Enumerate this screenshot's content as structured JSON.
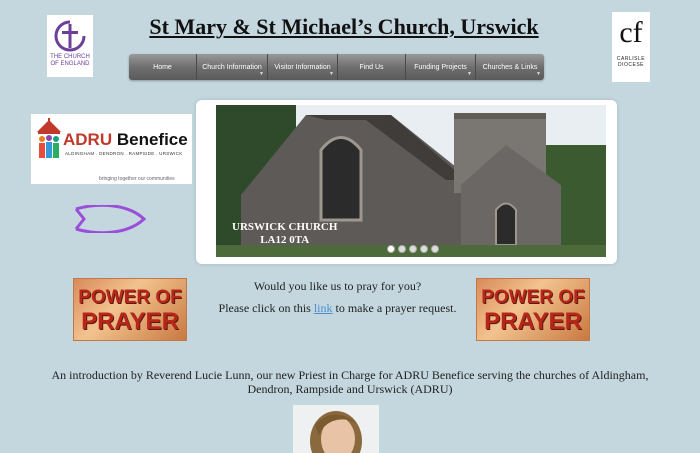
{
  "header": {
    "title": "St Mary & St Michael’s Church, Urswick",
    "coe_logo_text": "THE CHURCH OF ENGLAND",
    "carlisle_logo_mark": "cf",
    "carlisle_logo_text": "CARLISLE DIOCESE"
  },
  "nav": {
    "items": [
      {
        "label": "Home"
      },
      {
        "label": "Church Information"
      },
      {
        "label": "Visitor Information"
      },
      {
        "label": "Find Us"
      },
      {
        "label": "Funding Projects"
      },
      {
        "label": "Churches &  Links"
      }
    ]
  },
  "adru_logo": {
    "title_prefix": "ADRU",
    "title_suffix": " Benefice",
    "subtitle": "ALDINGHAM . DENDRON . RAMPSIDE . URSWICK",
    "tagline": "bringing together our communities"
  },
  "slideshow": {
    "caption_line1": "URSWICK CHURCH",
    "caption_line2": "LA12 0TA",
    "slide_count": 5,
    "active_slide": 1
  },
  "prayer": {
    "image_text_line1": "POWER OF",
    "image_text_line2": "PRAYER",
    "question": "Would you like us to pray for you?",
    "click_prefix": "Please click on this ",
    "link_text": "link",
    "click_suffix": " to make a prayer request."
  },
  "intro": {
    "text": "An introduction by Reverend Lucie Lunn, our new Priest in Charge for ADRU Benefice serving the churches of Aldingham, Dendron, Rampside and Urswick  (ADRU)"
  },
  "colors": {
    "page_background": "#c4d7df",
    "nav_background": "#6f6f6f",
    "link": "#4a8fd0",
    "coe_purple": "#6c3f99",
    "fish_purple": "#9b4fd8"
  }
}
